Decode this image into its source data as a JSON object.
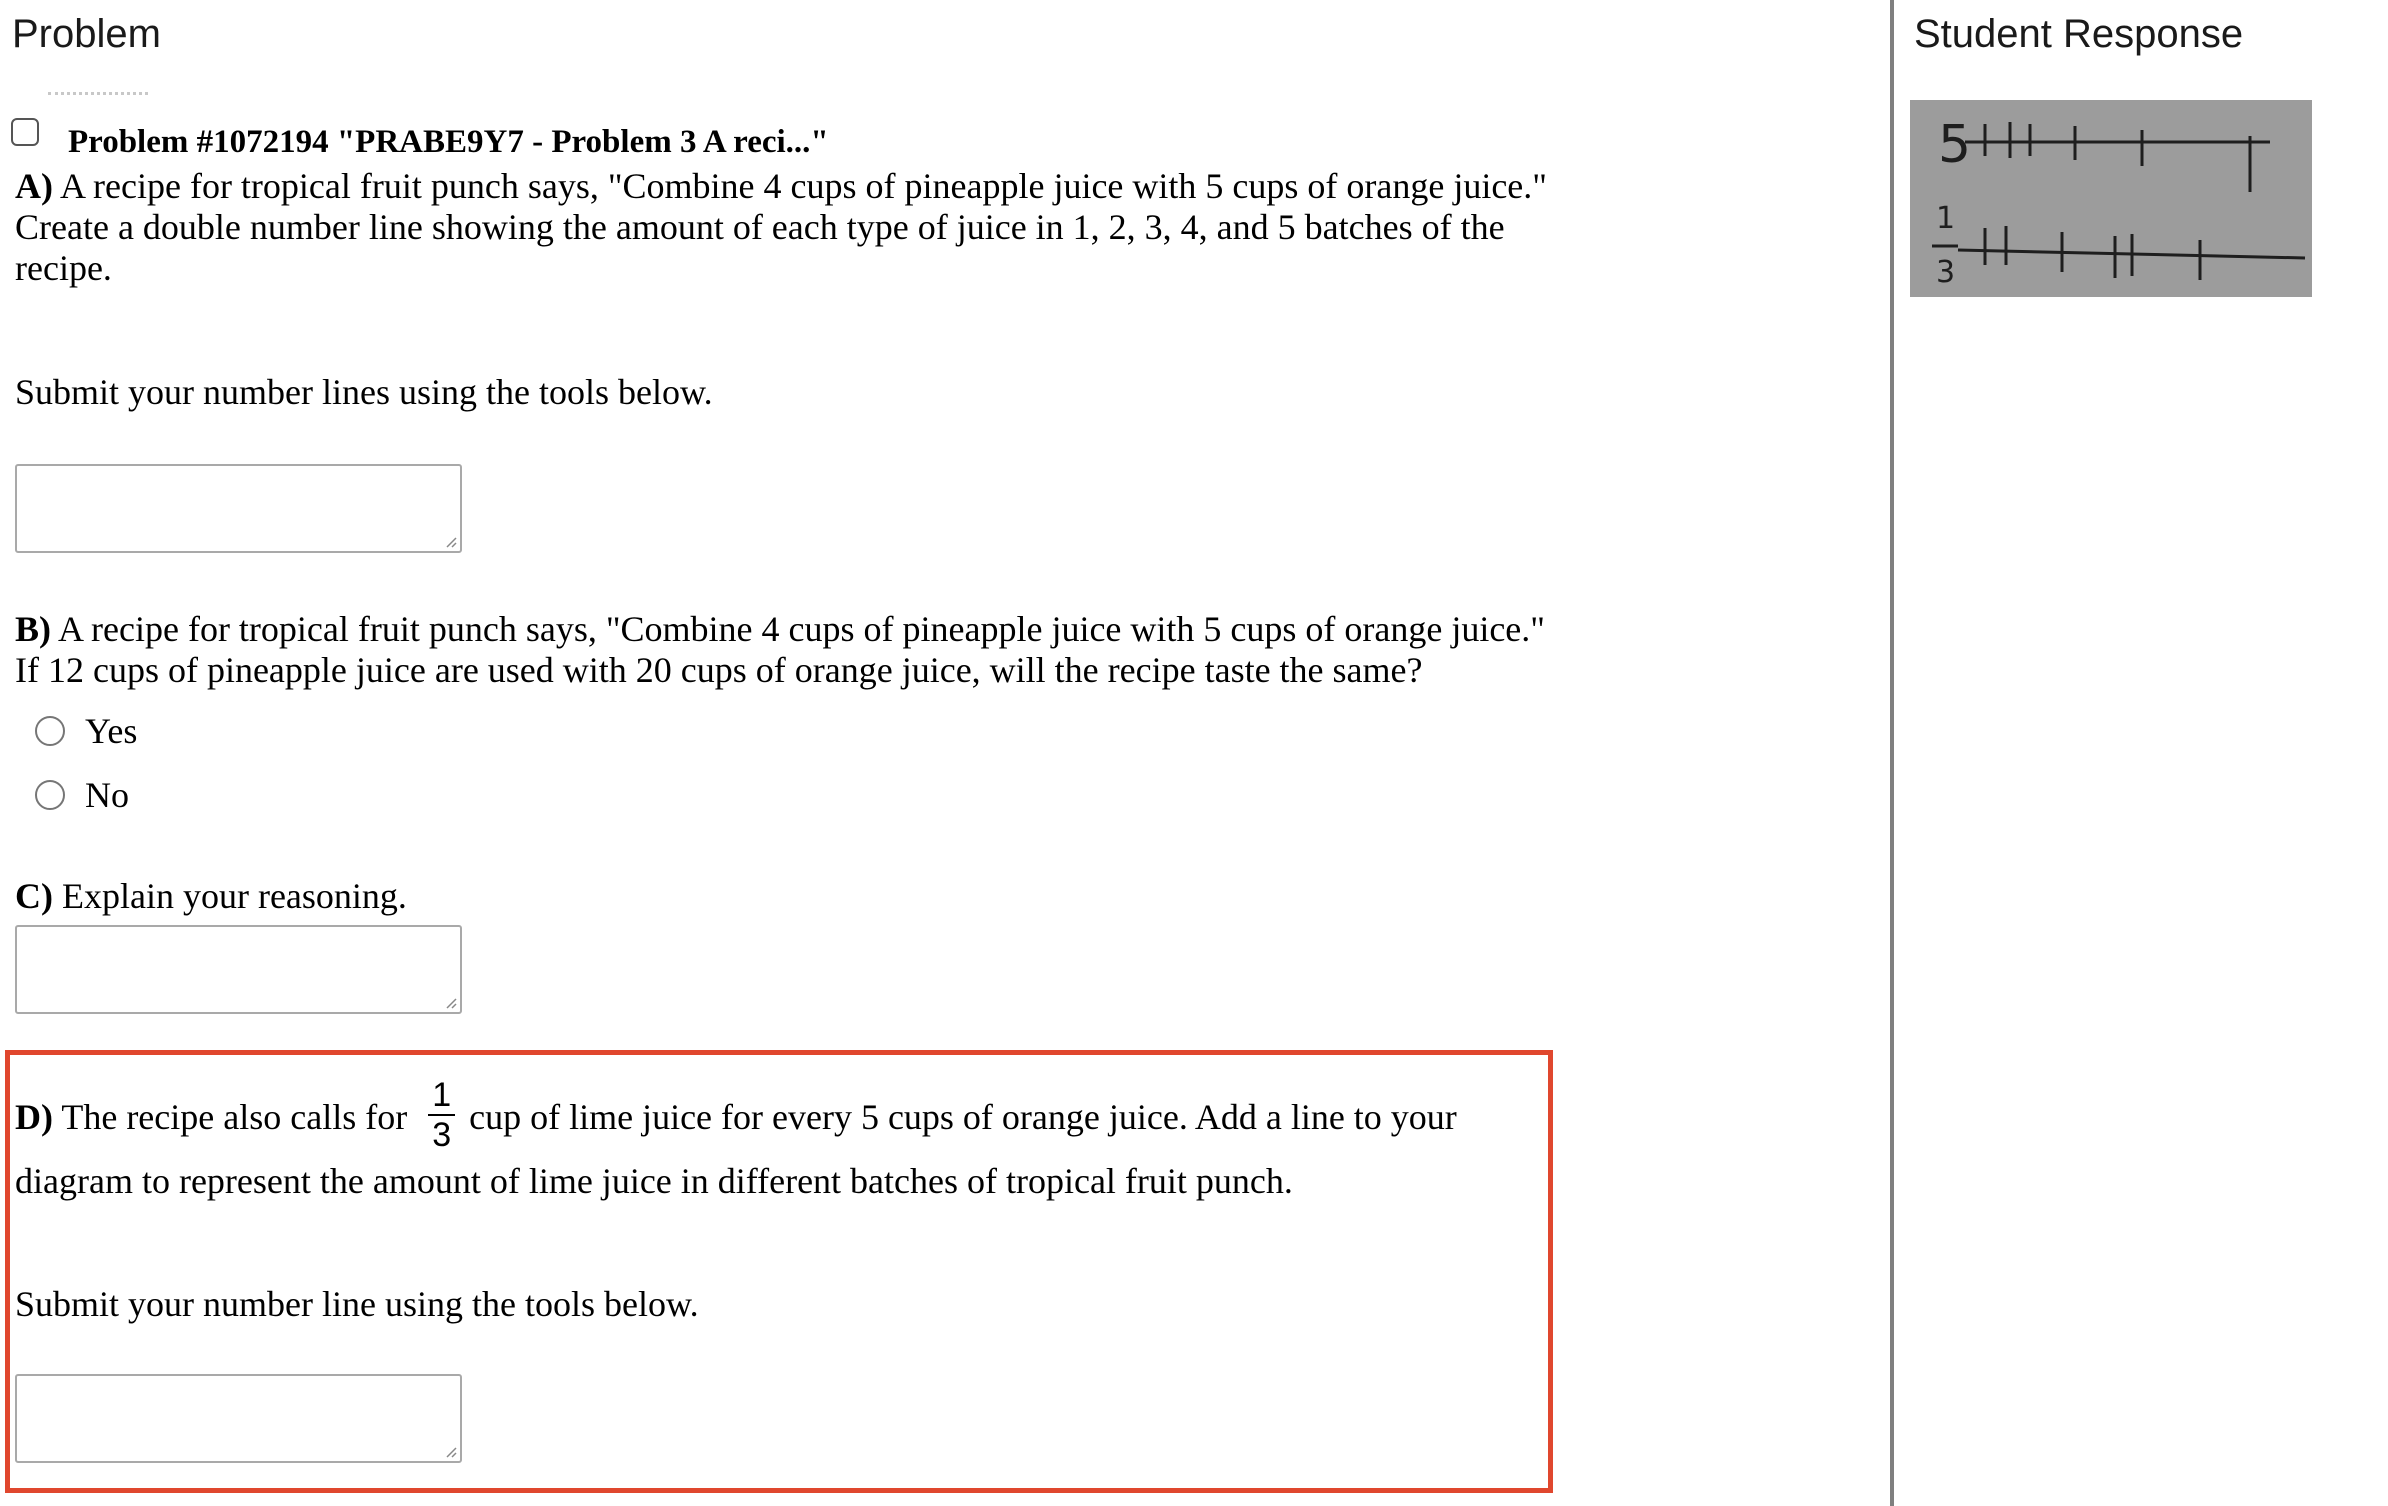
{
  "left_pane": {
    "title": "Problem"
  },
  "right_pane": {
    "title": "Student Response"
  },
  "problem": {
    "header": "Problem #1072194 \"PRABE9Y7 - Problem 3 A reci...\"",
    "part_a": {
      "label": "A)",
      "line1": " A recipe for tropical fruit punch says, \"Combine 4 cups of pineapple juice with 5 cups of orange juice.\"",
      "line2": "Create a double number line showing the amount of each type of juice in 1, 2, 3, 4, and 5 batches of the",
      "line3": "recipe.",
      "submit": "Submit your number lines using the tools below."
    },
    "part_b": {
      "label": "B)",
      "line1": " A recipe for tropical fruit punch says, \"Combine 4 cups of pineapple juice with 5 cups of orange juice.\"",
      "line2": "If 12 cups of pineapple juice are used with 20 cups of orange juice, will the recipe taste the same?",
      "options": [
        "Yes",
        "No"
      ]
    },
    "part_c": {
      "label": "C)",
      "text": " Explain your reasoning."
    },
    "part_d": {
      "label": "D)",
      "pre": " The recipe also calls for ",
      "frac_num": "1",
      "frac_den": "3",
      "post": "cup of lime juice for every 5 cups of orange juice. Add a line to your",
      "line2": "diagram to represent the amount of lime juice in different batches of tropical fruit punch.",
      "submit": "Submit your number line using the tools below."
    }
  },
  "student_response": {
    "line1_label": "5",
    "line2_num": "1",
    "line2_den": "3"
  },
  "colors": {
    "highlight_border": "#e0472e",
    "divider": "#7f7f7f",
    "response_bg": "#9c9c9c"
  }
}
